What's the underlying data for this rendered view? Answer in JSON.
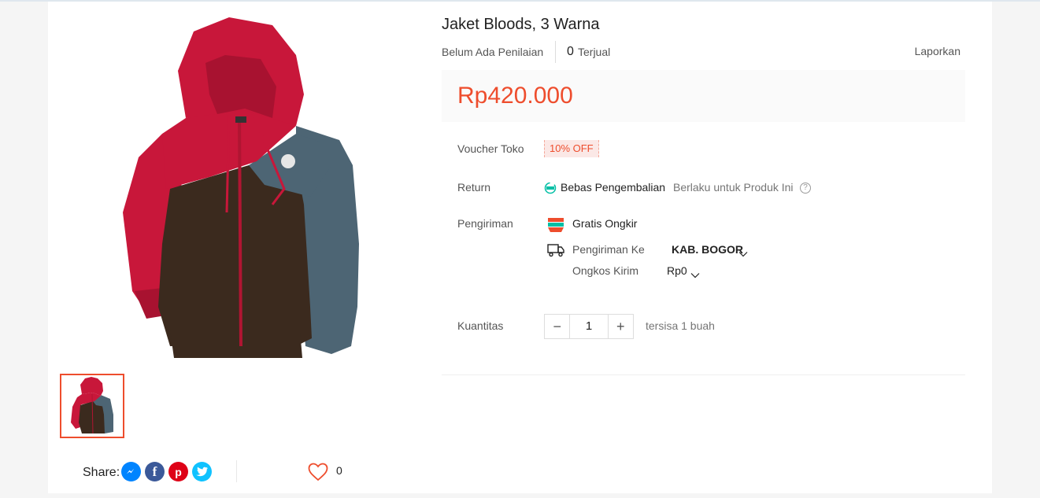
{
  "product": {
    "title": "Jaket Bloods, 3 Warna",
    "rating_text": "Belum Ada Penilaian",
    "sold_count": "0",
    "sold_label": "Terjual",
    "report_label": "Laporkan",
    "price": "Rp420.000"
  },
  "voucher": {
    "label": "Voucher Toko",
    "value": "10% OFF"
  },
  "return": {
    "label": "Return",
    "title": "Bebas Pengembalian",
    "sub": "Berlaku untuk Produk Ini",
    "help": "?"
  },
  "shipping": {
    "label": "Pengiriman",
    "free_label": "Gratis Ongkir",
    "to_label": "Pengiriman Ke",
    "to_value": "KAB. BOGOR",
    "cost_label": "Ongkos Kirim",
    "cost_value": "Rp0"
  },
  "quantity": {
    "label": "Kuantitas",
    "value": "1",
    "minus": "−",
    "plus": "+",
    "stock_text": "tersisa 1 buah"
  },
  "share": {
    "label": "Share:",
    "facebook_glyph": "f",
    "pinterest_glyph": "p"
  },
  "like": {
    "count": "0"
  },
  "colors": {
    "accent": "#ee4d2d",
    "jacket_red": "#c8173a",
    "jacket_brown": "#3b2a1e",
    "jacket_grey": "#4d6574"
  },
  "icons": [
    "messenger-icon",
    "facebook-icon",
    "pinterest-icon",
    "twitter-icon",
    "heart-icon",
    "truck-icon",
    "free-return-icon",
    "gratis-ongkir-icon",
    "chevron-down-icon",
    "help-icon"
  ]
}
